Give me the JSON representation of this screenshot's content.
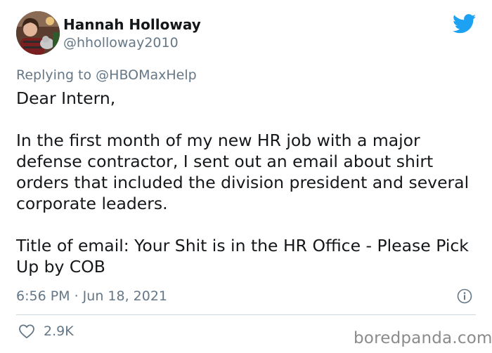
{
  "tweet": {
    "author": {
      "display_name": "Hannah Holloway",
      "handle": "@hholloway2010"
    },
    "reply": {
      "prefix": "Replying to ",
      "mention": "@HBOMaxHelp"
    },
    "text": "Dear Intern,\n\nIn the first month of my new HR job with a major defense contractor, I sent out an email about shirt orders that included the division president and several corporate leaders.\n\nTitle of email: Your Shit is in the HR Office - Please Pick Up by COB",
    "timestamp": "6:56 PM · Jun 18, 2021",
    "likes": "2.9K"
  },
  "watermark": "boredpanda.com",
  "icons": {
    "brand": "twitter-bird-icon",
    "info": "info-icon",
    "like": "heart-icon"
  },
  "colors": {
    "twitter_blue": "#1da1f2",
    "secondary_text": "#657786",
    "primary_text": "#14171a",
    "divider": "#ccd6dd"
  }
}
